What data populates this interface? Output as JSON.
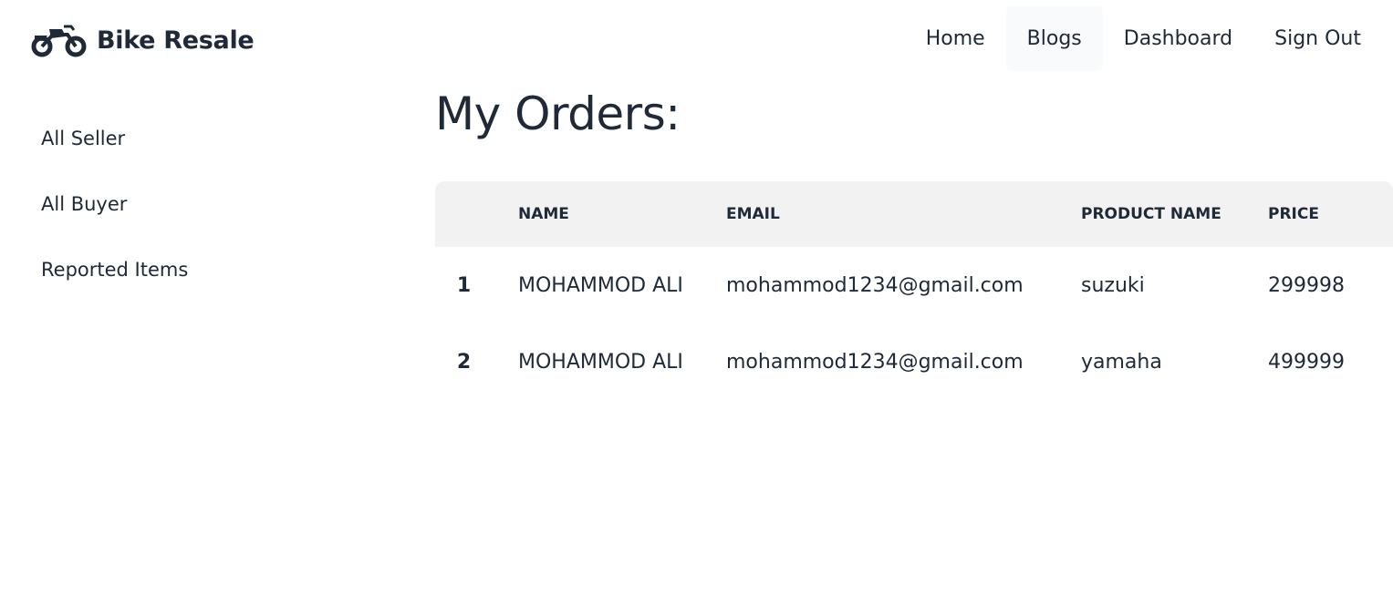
{
  "brand": {
    "name": "Bike Resale",
    "icon": "motorcycle-icon"
  },
  "nav": {
    "items": [
      {
        "label": "Home"
      },
      {
        "label": "Blogs"
      },
      {
        "label": "Dashboard"
      },
      {
        "label": "Sign Out"
      }
    ]
  },
  "sidebar": {
    "items": [
      {
        "label": "All Seller"
      },
      {
        "label": "All Buyer"
      },
      {
        "label": "Reported Items"
      }
    ]
  },
  "main": {
    "title": "My Orders:",
    "table": {
      "headers": [
        "",
        "NAME",
        "EMAIL",
        "PRODUCT NAME",
        "PRICE"
      ],
      "rows": [
        {
          "index": "1",
          "name": "MOHAMMOD ALI",
          "email": "mohammod1234@gmail.com",
          "product": "suzuki",
          "price": "299998"
        },
        {
          "index": "2",
          "name": "MOHAMMOD ALI",
          "email": "mohammod1234@gmail.com",
          "product": "yamaha",
          "price": "499999"
        }
      ]
    }
  },
  "colors": {
    "text": "#1f2937",
    "header_bg": "#f2f2f2",
    "active_nav_bg": "#f9fafb"
  }
}
